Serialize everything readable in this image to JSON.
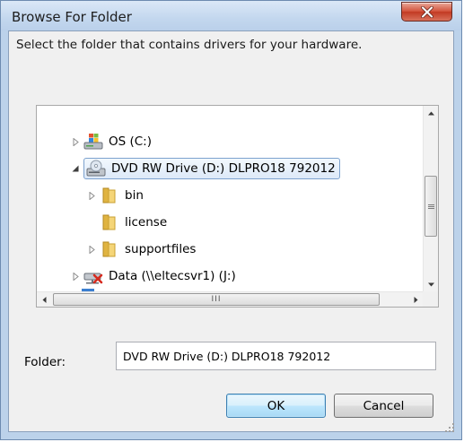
{
  "window": {
    "title": "Browse For Folder",
    "close_icon": "close-icon"
  },
  "instruction": "Select the folder that contains drivers for your hardware.",
  "tree": {
    "items": [
      {
        "label": "OS (C:)",
        "icon": "windows-drive-icon",
        "expander": "collapsed"
      },
      {
        "label": "DVD RW Drive (D:) DLPRO18 792012",
        "icon": "dvd-drive-icon",
        "expander": "expanded",
        "selected": true
      },
      {
        "label": "bin",
        "icon": "folder-icon",
        "expander": "collapsed"
      },
      {
        "label": "license",
        "icon": "folder-icon",
        "expander": "none"
      },
      {
        "label": "supportfiles",
        "icon": "folder-icon",
        "expander": "collapsed"
      },
      {
        "label": "Data (\\\\eltecsvr1) (J:)",
        "icon": "network-drive-disconnected-icon",
        "expander": "collapsed"
      }
    ],
    "hscroll_thumb_glyph": "III"
  },
  "folder": {
    "label": "Folder:",
    "value": "DVD RW Drive (D:) DLPRO18 792012"
  },
  "buttons": {
    "ok": "OK",
    "cancel": "Cancel"
  },
  "colors": {
    "selection_border": "#7da2ce",
    "default_button_border": "#3c7fb1",
    "close_button": "#c23a23"
  }
}
